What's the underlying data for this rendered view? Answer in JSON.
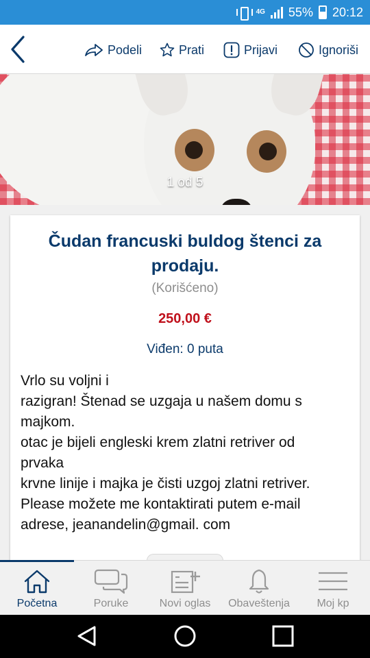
{
  "status_bar": {
    "network_label": "4G",
    "battery": "55%",
    "time": "20:12"
  },
  "header": {
    "actions": [
      {
        "label": "Podeli",
        "icon": "share-icon"
      },
      {
        "label": "Prati",
        "icon": "star-icon"
      },
      {
        "label": "Prijavi",
        "icon": "report-icon"
      },
      {
        "label": "Ignoriši",
        "icon": "block-icon"
      }
    ]
  },
  "gallery": {
    "counter": "1 od 5"
  },
  "listing": {
    "title": "Čudan francuski buldog štenci za prodaju.",
    "condition": "(Korišćeno)",
    "price": "250,00 €",
    "views": "Viđen: 0 puta",
    "description_lines": [
      "Vrlo su voljni i",
      "razigran! Štenad se uzgaja u našem domu s",
      "majkom.",
      "otac je bijeli engleski krem zlatni retriver od",
      "prvaka",
      "krvne linije i majka je čisti uzgoj zlatni retriver.",
      "Please možete me kontaktirati putem e-mail",
      "adrese, jeanandelin@gmail. com"
    ]
  },
  "tabs": [
    {
      "label": "Početna",
      "icon": "home-icon",
      "active": true
    },
    {
      "label": "Poruke",
      "icon": "messages-icon",
      "active": false
    },
    {
      "label": "Novi oglas",
      "icon": "new-ad-icon",
      "active": false
    },
    {
      "label": "Obaveštenja",
      "icon": "bell-icon",
      "active": false
    },
    {
      "label": "Moj kp",
      "icon": "menu-icon",
      "active": false
    }
  ],
  "colors": {
    "status_bar": "#2a8ed6",
    "brand_navy": "#0b3a6b",
    "price_red": "#c0111c",
    "muted_gray": "#8d8d8d"
  }
}
